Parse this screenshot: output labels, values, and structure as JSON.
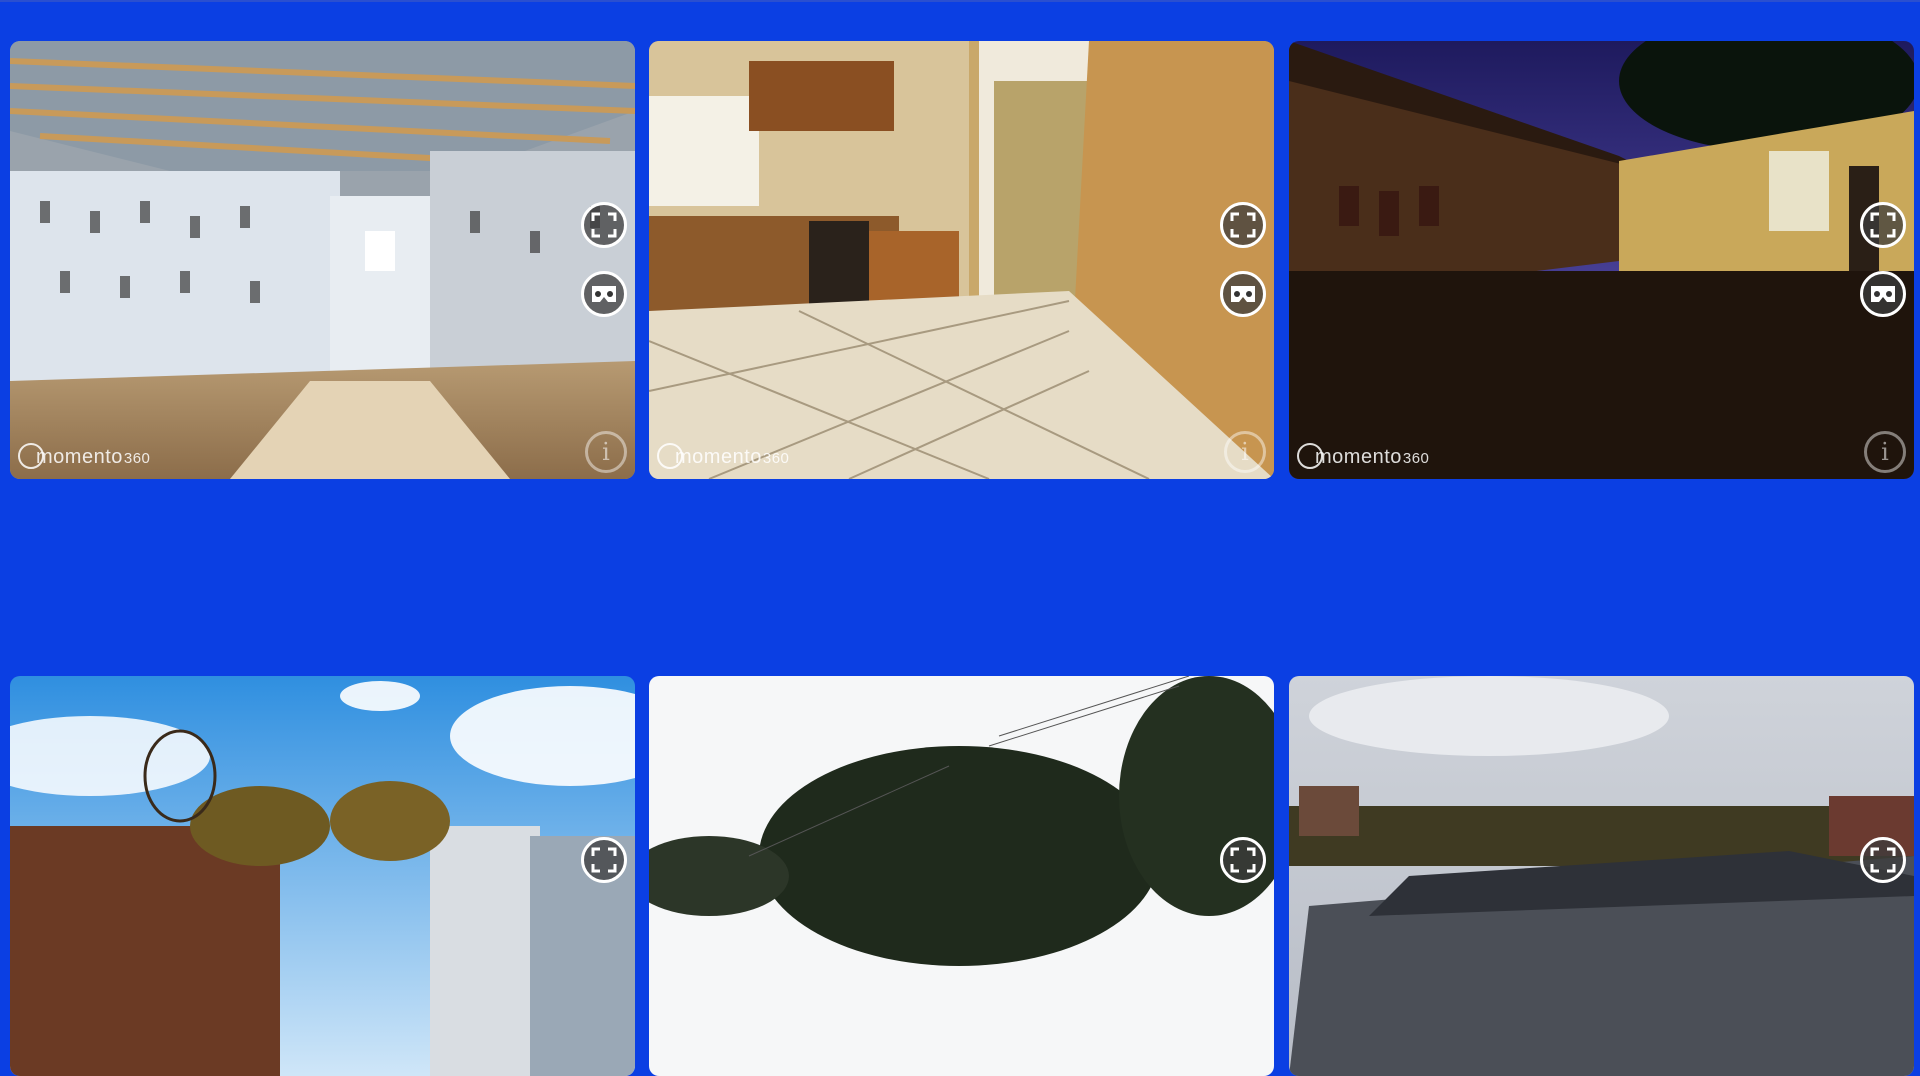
{
  "brand": {
    "name": "momento",
    "suffix": "360"
  },
  "controls": {
    "fullscreen_icon": "fullscreen-icon",
    "vr_icon": "vr-headset-icon",
    "info_glyph": "i"
  },
  "cards": [
    {
      "scene": "unfinished brick room"
    },
    {
      "scene": "kitchen with tiled floor"
    },
    {
      "scene": "courtyard at dusk"
    },
    {
      "scene": "campus under blue sky"
    },
    {
      "scene": "trees under overcast sky"
    },
    {
      "scene": "skatepark under cloudy sky"
    }
  ],
  "colors": {
    "background": "#0b3fe3",
    "card_radius_color": "#ffffff"
  }
}
